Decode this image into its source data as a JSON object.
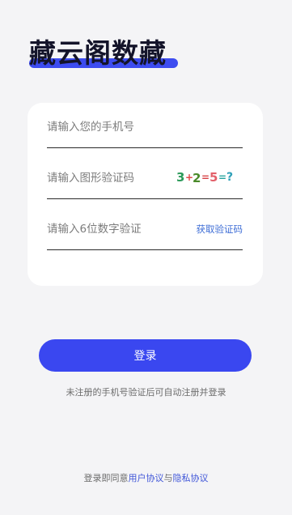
{
  "brand": {
    "title": "藏云阁数藏",
    "underline_color": "#3d4cf0"
  },
  "form": {
    "phone_placeholder": "请输入您的手机号",
    "captcha_placeholder": "请输入图形验证码",
    "captcha_image_text": "3+2=5=?",
    "sms_placeholder": "请输入6位数字验证",
    "get_sms_code_label": "获取验证码"
  },
  "actions": {
    "login_label": "登录",
    "login_color": "#3a47f0"
  },
  "notes": {
    "auto_register_hint": "未注册的手机号验证后可自动注册并登录",
    "agreement_prefix": "登录即同意",
    "user_agreement_label": "用户协议",
    "agreement_joiner": "与",
    "privacy_agreement_label": "隐私协议"
  }
}
